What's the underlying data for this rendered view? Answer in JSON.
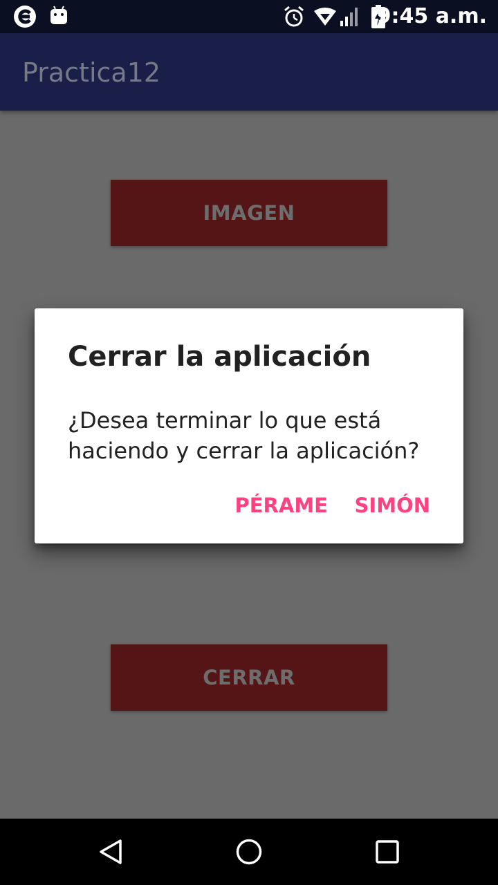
{
  "status_bar": {
    "time": "9:45 a.m.",
    "icons": [
      "browser-e-icon",
      "android-icon",
      "alarm-icon",
      "wifi-icon",
      "signal-icon",
      "battery-charging-icon"
    ]
  },
  "app_bar": {
    "title": "Practica12"
  },
  "content": {
    "image_button_label": "IMAGEN",
    "close_button_label": "CERRAR"
  },
  "dialog": {
    "title": "Cerrar la aplicación",
    "message": "¿Desea terminar lo que está haciendo y cerrar la aplicación?",
    "negative_label": "PÉRAME",
    "positive_label": "SIMÓN"
  },
  "nav_bar": {
    "icons": [
      "back-icon",
      "home-icon",
      "recents-icon"
    ]
  },
  "colors": {
    "status_bar": "#0b0f22",
    "app_bar": "#191f48",
    "scrim_background": "#6a6a6a",
    "button_background": "#551517",
    "dialog_accent": "#ff4081"
  }
}
